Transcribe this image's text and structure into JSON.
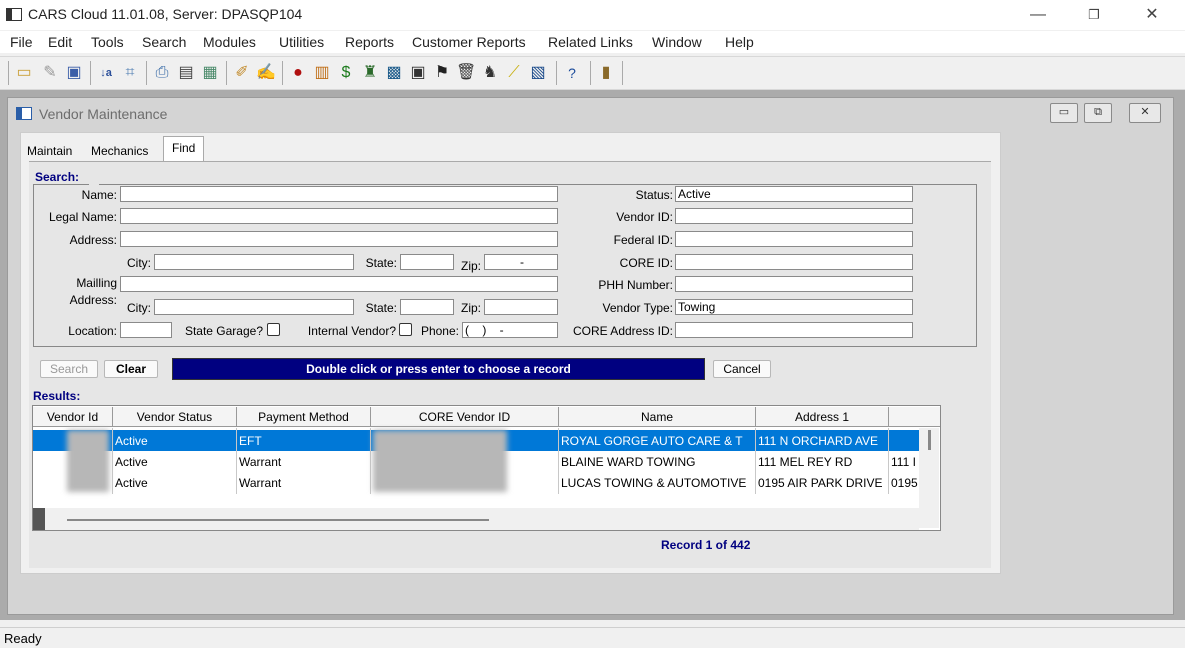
{
  "window": {
    "title": "CARS Cloud 11.01.08, Server: DPASQP104",
    "minimize": "—",
    "restore": "❐",
    "close": "✕"
  },
  "menu": [
    "File",
    "Edit",
    "Tools",
    "Search",
    "Modules",
    "Utilities",
    "Reports",
    "Customer Reports",
    "Related Links",
    "Window",
    "Help"
  ],
  "toolbar": {
    "icons": [
      "new-record-icon",
      "edit-icon",
      "save-icon",
      "sort-icon",
      "find-icon",
      "print-icon",
      "report-icon",
      "preview-icon",
      "tool-icon",
      "document-edit-icon",
      "car-icon",
      "fuel-icon",
      "money-icon",
      "vendor-icon",
      "map-icon",
      "ticket-icon",
      "flag-icon",
      "trash-icon",
      "mechanic-icon",
      "pencil-icon",
      "report-card-icon",
      "help-icon",
      "exit-icon"
    ]
  },
  "child": {
    "title": "Vendor Maintenance",
    "btn_min": "▭",
    "btn_max": "⧉",
    "btn_close": "✕"
  },
  "tabs": {
    "maintain": "Maintain",
    "mechanics": "Mechanics",
    "find": "Find"
  },
  "search": {
    "heading": "Search:",
    "name_label": "Name:",
    "legal_name_label": "Legal Name:",
    "address_label": "Address:",
    "city_label": "City:",
    "state_label": "State:",
    "zip_label": "Zip:",
    "zip_value": "-",
    "mailing_label": "Mailling",
    "mailing_label2": "Address:",
    "mail_city_label": "City:",
    "mail_state_label": "State:",
    "mail_zip_label": "Zip:",
    "location_label": "Location:",
    "state_garage_label": "State Garage?",
    "internal_vendor_label": "Internal Vendor?",
    "phone_label": "Phone:",
    "phone_value": "(    )    -",
    "status_label": "Status:",
    "status_value": "Active",
    "vendor_id_label": "Vendor ID:",
    "federal_id_label": "Federal ID:",
    "core_id_label": "CORE ID:",
    "phh_label": "PHH Number:",
    "vendor_type_label": "Vendor Type:",
    "vendor_type_value": "Towing",
    "core_address_label": "CORE Address ID:"
  },
  "buttons": {
    "search": "Search",
    "clear": "Clear",
    "cancel": "Cancel"
  },
  "message": "Double click or press enter to choose a record",
  "results": {
    "heading": "Results:",
    "columns": [
      "Vendor Id",
      "Vendor Status",
      "Payment Method",
      "CORE Vendor ID",
      "Name",
      "Address 1"
    ],
    "rows": [
      {
        "status": "Active",
        "payment": "EFT",
        "name": "ROYAL GORGE AUTO CARE & T",
        "address1": "111 N ORCHARD AVE",
        "extra": ""
      },
      {
        "status": "Active",
        "payment": "Warrant",
        "name": "BLAINE WARD TOWING",
        "address1": "111 MEL REY RD",
        "extra": "111 I"
      },
      {
        "status": "Active",
        "payment": "Warrant",
        "name": "LUCAS TOWING & AUTOMOTIVE",
        "address1": "0195 AIR PARK DRIVE",
        "extra": "0195"
      }
    ],
    "record_text": "Record 1 of 442"
  },
  "status_bar": "Ready",
  "colors": {
    "selection": "#0078d7",
    "message_bg": "#000080",
    "heading": "#000080"
  }
}
